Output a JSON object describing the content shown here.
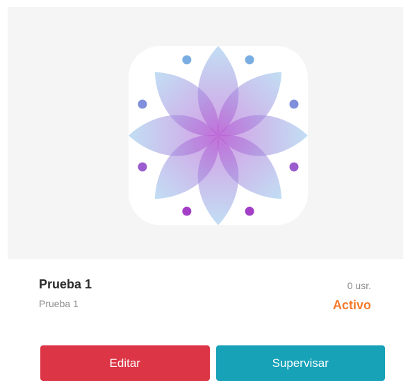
{
  "card": {
    "title": "Prueba 1",
    "subtitle": "Prueba 1",
    "users": "0 usr.",
    "status": "Activo",
    "status_color": "#f47a2b",
    "logo_icon": "lotus-flower-icon"
  },
  "actions": {
    "edit_label": "Editar",
    "edit_color": "#dc3545",
    "supervise_label": "Supervisar",
    "supervise_color": "#17a2b8"
  }
}
